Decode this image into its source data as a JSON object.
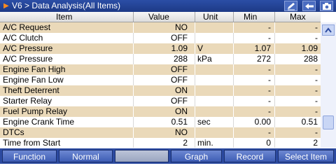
{
  "window": {
    "title": "V6 > Data Analysis(All Items)",
    "icons": [
      "pencil-icon",
      "back-arrow-icon",
      "camera-icon"
    ]
  },
  "columns": {
    "item": "Item",
    "value": "Value",
    "unit": "Unit",
    "min": "Min",
    "max": "Max"
  },
  "rows": [
    {
      "item": "A/C Request",
      "value": "NO",
      "unit": "",
      "min": "-",
      "max": "-"
    },
    {
      "item": "A/C Clutch",
      "value": "OFF",
      "unit": "",
      "min": "-",
      "max": "-"
    },
    {
      "item": "A/C Pressure",
      "value": "1.09",
      "unit": "V",
      "min": "1.07",
      "max": "1.09"
    },
    {
      "item": "A/C Pressure",
      "value": "288",
      "unit": "kPa",
      "min": "272",
      "max": "288"
    },
    {
      "item": "Engine Fan High",
      "value": "OFF",
      "unit": "",
      "min": "-",
      "max": "-"
    },
    {
      "item": "Engine Fan Low",
      "value": "OFF",
      "unit": "",
      "min": "-",
      "max": "-"
    },
    {
      "item": "Theft Deterrent",
      "value": "ON",
      "unit": "",
      "min": "-",
      "max": "-"
    },
    {
      "item": "Starter Relay",
      "value": "OFF",
      "unit": "",
      "min": "-",
      "max": "-"
    },
    {
      "item": "Fuel Pump Relay",
      "value": "ON",
      "unit": "",
      "min": "-",
      "max": "-"
    },
    {
      "item": "Engine Crank Time",
      "value": "0.51",
      "unit": "sec",
      "min": "0.00",
      "max": "0.51"
    },
    {
      "item": "DTCs",
      "value": "NO",
      "unit": "",
      "min": "-",
      "max": "-"
    },
    {
      "item": "Time from Start",
      "value": "2",
      "unit": "min.",
      "min": "0",
      "max": "2"
    }
  ],
  "toolbar": {
    "function": "Function",
    "normal": "Normal",
    "blank": "",
    "graph": "Graph",
    "record": "Record",
    "select_item": "Select Item"
  },
  "colors": {
    "title_bar": "#1d3a86",
    "row_tan": "#ead9b9",
    "row_white": "#ffffff",
    "toolbar": "#2c4aa0",
    "accent_arrow": "#ff8a1e"
  }
}
